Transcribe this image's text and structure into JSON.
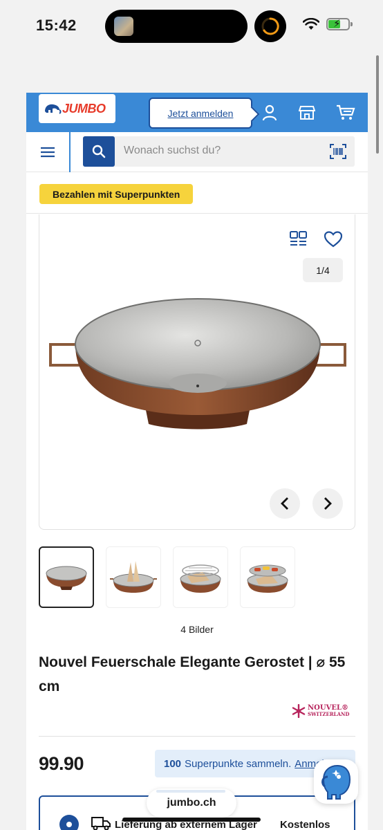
{
  "status_bar": {
    "time": "15:42"
  },
  "header": {
    "logo_text": "JUMBO",
    "login_label": "Jetzt anmelden",
    "icons": [
      "user-icon",
      "store-icon",
      "cart-icon"
    ]
  },
  "search": {
    "placeholder": "Wonach suchst du?",
    "icons": [
      "menu-icon",
      "search-icon",
      "barcode-scan-icon"
    ]
  },
  "promo": {
    "label": "Bezahlen mit Superpunkten"
  },
  "gallery": {
    "counter": "1/4",
    "image_count_label": "4 Bilder",
    "current_index": 1,
    "total": 4
  },
  "product": {
    "title": "Nouvel Feuerschale Elegante Gerostet | ⌀ 55 cm",
    "brand_line1": "NOUVEL®",
    "brand_line2": "SWITZERLAND",
    "price": "99.90"
  },
  "points": {
    "amount": "100",
    "text": "Superpunkte sammeln.",
    "link": "Anmelden"
  },
  "delivery": {
    "label": "Lieferung ab externem Lager",
    "cost": "Kostenlos"
  },
  "browser": {
    "url": "jumbo.ch"
  },
  "colors": {
    "header_blue": "#3a89d6",
    "navy": "#1d4f9a",
    "promo_yellow": "#f6d33c",
    "logo_red": "#e73b2a",
    "points_bg": "#e3eefa"
  }
}
